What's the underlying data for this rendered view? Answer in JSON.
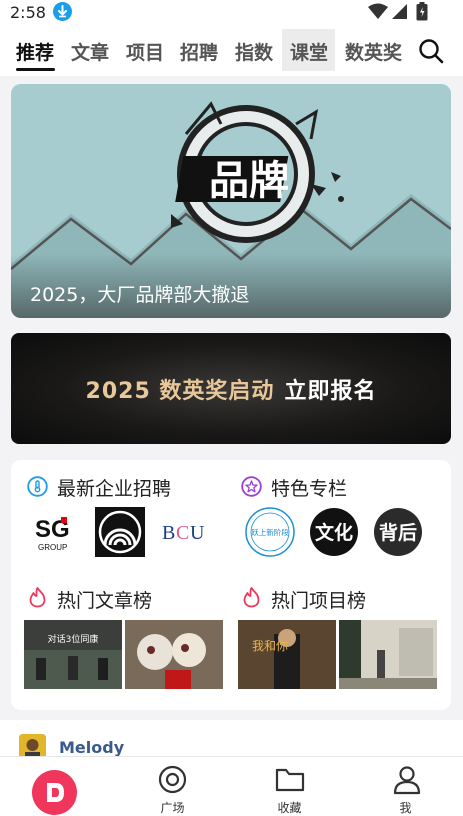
{
  "status_bar": {
    "time": "2:58"
  },
  "tabs": [
    {
      "label": "推荐",
      "active": true
    },
    {
      "label": "文章",
      "active": false
    },
    {
      "label": "项目",
      "active": false
    },
    {
      "label": "招聘",
      "active": false
    },
    {
      "label": "指数",
      "active": false
    },
    {
      "label": "课堂",
      "active": false
    },
    {
      "label": "数英奖",
      "active": false
    }
  ],
  "hero": {
    "caption": "2025，大厂品牌部大撤退",
    "logo_text": "品牌"
  },
  "banner": {
    "text_gold": "2025 数英奖启动",
    "text_white": "立即报名"
  },
  "sections": {
    "jobs": {
      "title": "最新企业招聘",
      "icon": "thermometer-icon"
    },
    "columns": {
      "title": "特色专栏",
      "icon": "star-badge-icon"
    },
    "hot_articles": {
      "title": "热门文章榜",
      "icon": "flame-icon"
    },
    "hot_projects": {
      "title": "热门项目榜",
      "icon": "flame-icon"
    }
  },
  "job_logos": [
    {
      "name": "SG GROUP",
      "text_main": "SG",
      "text_sub": "GROUP"
    },
    {
      "name": "concentric",
      "text_main": ""
    },
    {
      "name": "BCU",
      "text_main": "B",
      "text_accent": "C",
      "text_tail": "U"
    }
  ],
  "column_logos": [
    {
      "name": "跃上新阶段",
      "text_main": "跃上新阶段"
    },
    {
      "name": "文化",
      "text_main": "文化"
    },
    {
      "name": "背后",
      "text_main": "背后"
    }
  ],
  "article_thumbs": [
    {
      "overlay": "对话3位同康"
    },
    {
      "overlay": ""
    }
  ],
  "project_thumbs": [
    {
      "overlay": "我和你"
    },
    {
      "overlay": ""
    }
  ],
  "feed_peek": {
    "author": "Melody"
  },
  "bottom_nav": [
    {
      "label": "",
      "icon": "home-d-icon"
    },
    {
      "label": "广场",
      "icon": "target-icon"
    },
    {
      "label": "收藏",
      "icon": "folder-icon"
    },
    {
      "label": "我",
      "icon": "person-icon"
    }
  ],
  "colors": {
    "brand": "#f0365b",
    "download_icon": "#1a9dea",
    "section_icon_blue": "#1a9dea",
    "section_icon_purple": "#9b3fd6",
    "flame": "#f0365b",
    "banner_gold": "#e8c89a"
  }
}
